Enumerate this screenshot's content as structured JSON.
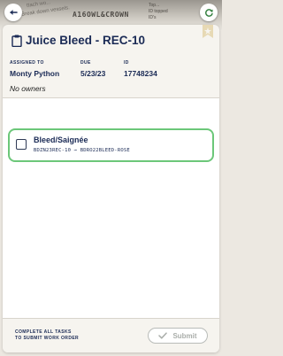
{
  "backdrop": {
    "text_main": "A16OWL&CROWN",
    "text_faint_1": "ttach wo...",
    "text_faint_2": "Break down vessels.",
    "text_faint_3": "Top...",
    "text_faint_4": "ID topped",
    "text_faint_5": "ID's"
  },
  "header": {
    "title": "Juice Bleed - REC-10"
  },
  "meta": {
    "assigned_label": "ASSIGNED TO",
    "assigned_value": "Monty Python",
    "due_label": "DUE",
    "due_value": "5/23/23",
    "id_label": "ID",
    "id_value": "17748234"
  },
  "owners_text": "No owners",
  "task": {
    "title": "Bleed/Saignée",
    "from": "BDZN23REC-10",
    "arrow": "→",
    "to": "BDRO22BLEED-ROSE"
  },
  "footer": {
    "note_line1": "COMPLETE ALL TASKS",
    "note_line2": "TO SUBMIT WORK ORDER",
    "submit_label": "Submit"
  },
  "colors": {
    "primary_navy": "#1a2a55",
    "task_border_green": "#6cc779",
    "disabled_gray": "#a9ada9"
  },
  "icons": [
    "back-arrow-icon",
    "refresh-icon",
    "clipboard-icon",
    "bookmark-icon",
    "checkbox-icon",
    "check-icon"
  ]
}
